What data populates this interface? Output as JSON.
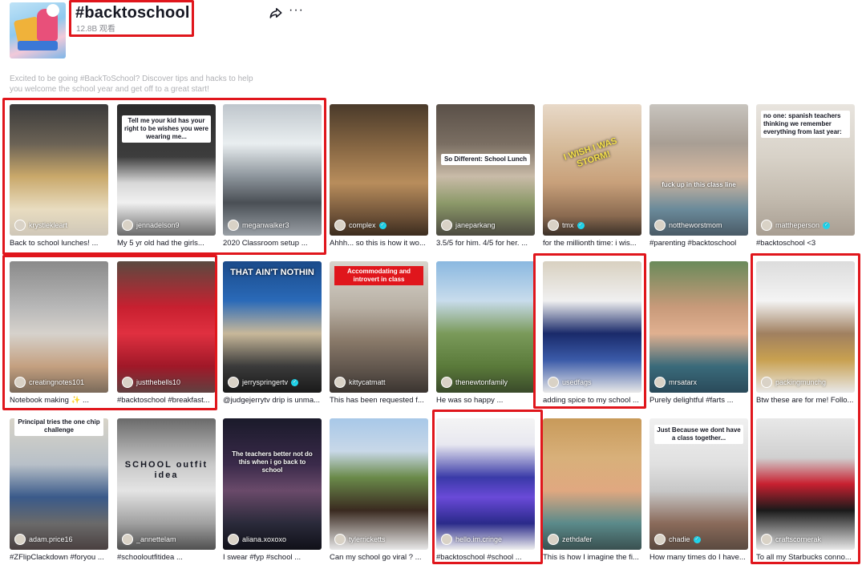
{
  "header": {
    "title": "#backtoschool",
    "views": "12.8B 观看",
    "description": "Excited to be going #BackToSchool? Discover tips and hacks to help you welcome the school year and get off to a great start!",
    "share_icon": "share-arrow-icon",
    "more_icon": "more-dots-icon",
    "more_glyph": "···"
  },
  "videos": [
    {
      "user": "krystlekleart",
      "caption": "Back to school lunches! ...",
      "overlay": "",
      "verified": false
    },
    {
      "user": "jennadelson9",
      "caption": "My 5 yr old had the girls...",
      "overlay": "Tell me your kid has your right to be wishes you were wearing me...",
      "verified": false
    },
    {
      "user": "meganwalker3",
      "caption": "2020 Classroom setup ...",
      "overlay": "",
      "verified": false
    },
    {
      "user": "complex",
      "caption": "Ahhh... so this is how it wo...",
      "overlay": "",
      "verified": true
    },
    {
      "user": "janeparkang",
      "caption": "3.5/5 for him. 4/5 for her. ...",
      "overlay": "So Different: School Lunch",
      "verified": false
    },
    {
      "user": "tmx",
      "caption": "for the millionth time: i wis...",
      "overlay": "I WISH I WAS STORM!",
      "verified": true
    },
    {
      "user": "nottheworstmom",
      "caption": "#parenting #backtoschool",
      "overlay": "fuck up in this class line",
      "verified": false
    },
    {
      "user": "mattheperson",
      "caption": "#backtoschool <3",
      "overlay": "no one: spanish teachers thinking we remember everything from last year:",
      "verified": true
    },
    {
      "user": "creatingnotes101",
      "caption": "Notebook making ✨ ...",
      "overlay": "",
      "verified": false
    },
    {
      "user": "justthebells10",
      "caption": "#backtoschool #breakfast...",
      "overlay": "",
      "verified": false
    },
    {
      "user": "jerryspringertv",
      "caption": "@judgejerrytv drip is unma...",
      "overlay": "THAT AIN'T NOTHIN",
      "verified": true
    },
    {
      "user": "kittycatmatt",
      "caption": "This has been requested f...",
      "overlay": "Accommodating and introvert in class",
      "verified": false
    },
    {
      "user": "thenewtonfamily",
      "caption": "He was so happy ...",
      "overlay": "",
      "verified": false
    },
    {
      "user": "usedfags",
      "caption": "adding spice to my school ...",
      "overlay": "",
      "verified": false
    },
    {
      "user": "mrsatarx",
      "caption": "Purely delightful #farts ...",
      "overlay": "",
      "verified": false
    },
    {
      "user": "packingmunchg",
      "caption": "Btw these are for me! Follo...",
      "overlay": "",
      "verified": false
    },
    {
      "user": "adam.price16",
      "caption": "#ZFlipClackdown #foryou ...",
      "overlay": "Principal tries the one chip challenge",
      "verified": false
    },
    {
      "user": "_annettelam",
      "caption": "#schooloutfitidea ...",
      "overlay": "SCHOOL outfit idea",
      "verified": false
    },
    {
      "user": "aliana.xoxoxo",
      "caption": "I swear #fyp #school ...",
      "overlay": "The teachers better not do this when i go back to school",
      "verified": false
    },
    {
      "user": "tylerricketts",
      "caption": "Can my school go viral ? ...",
      "overlay": "",
      "verified": false
    },
    {
      "user": "hello.im.cringe",
      "caption": "#backtoschool #school ...",
      "overlay": "",
      "verified": false
    },
    {
      "user": "zethdafer",
      "caption": "This is how I imagine the fi...",
      "overlay": "",
      "verified": false
    },
    {
      "user": "chadie",
      "caption": "How many times do I have...",
      "overlay": "Just Because we dont have a class together...",
      "verified": true
    },
    {
      "user": "craftscornerak",
      "caption": "To all my Starbucks conno...",
      "overlay": "",
      "verified": false
    }
  ],
  "colors": {
    "highlight": "#e0161c",
    "text": "#161823",
    "muted": "#8a8b91"
  }
}
